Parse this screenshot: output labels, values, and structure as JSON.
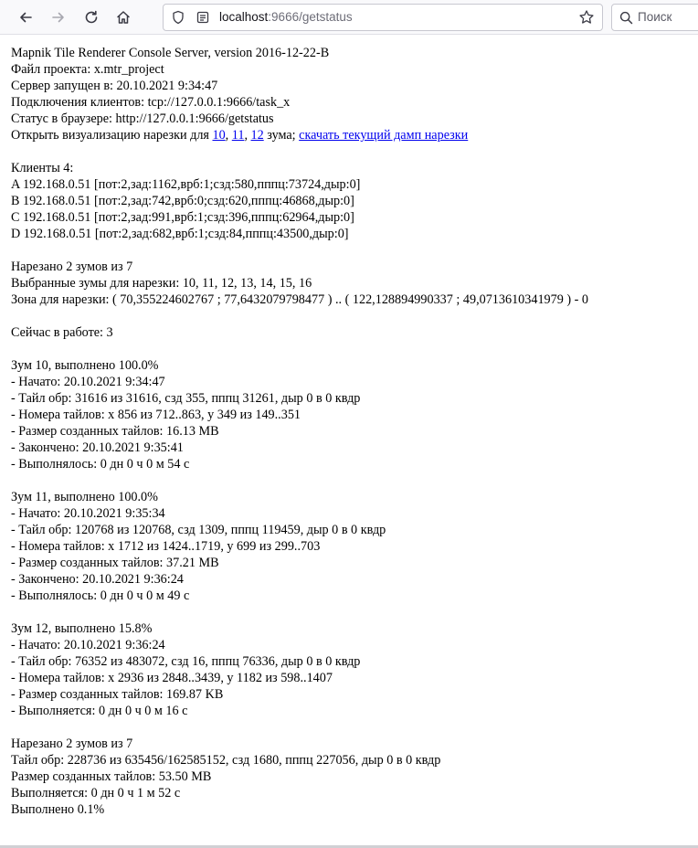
{
  "browser": {
    "url_host": "localhost",
    "url_rest": ":9666/getstatus",
    "search_placeholder": "Поиск"
  },
  "page": {
    "header": [
      "Mapnik Tile Renderer Console Server, version 2016-12-22-B",
      "Файл проекта: x.mtr_project",
      "Сервер запущен в: 20.10.2021 9:34:47",
      "Подключения клиентов: tcp://127.0.0.1:9666/task_x",
      "Статус в браузере: http://127.0.0.1:9666/getstatus"
    ],
    "viz_line": {
      "prefix": "Открыть визуализацию нарезки для ",
      "link_10": "10",
      "sep1": ", ",
      "link_11": "11",
      "sep2": ", ",
      "link_12": "12",
      "suffix": " зума; ",
      "dump_link": "скачать текущий дамп нарезки"
    },
    "clients": [
      "Клиенты 4:",
      "A 192.168.0.51 [пот:2,зад:1162,врб:1;сзд:580,пппц:73724,дыр:0]",
      "B 192.168.0.51 [пот:2,зад:742,врб:0;сзд:620,пппц:46868,дыр:0]",
      "C 192.168.0.51 [пот:2,зад:991,врб:1;сзд:396,пппц:62964,дыр:0]",
      "D 192.168.0.51 [пот:2,зад:682,врб:1;сзд:84,пппц:43500,дыр:0]"
    ],
    "summary": [
      "Нарезано 2 зумов из 7",
      "Выбранные зумы для нарезки: 10, 11, 12, 13, 14, 15, 16",
      "Зона для нарезки: ( 70,355224602767 ; 77,6432079798477 ) .. ( 122,128894990337 ; 49,0713610341979 ) - 0"
    ],
    "working": "Сейчас в работе: 3",
    "zoom10": [
      "Зум 10, выполнено 100.0%",
      "- Начато: 20.10.2021 9:34:47",
      "- Тайл обр: 31616 из 31616, сзд 355, пппц 31261, дыр 0 в 0 квдр",
      "- Номера тайлов: x 856 из 712..863, y 349 из 149..351",
      "- Размер созданных тайлов: 16.13 MB",
      "- Закончено: 20.10.2021 9:35:41",
      "- Выполнялось: 0 дн 0 ч 0 м 54 с"
    ],
    "zoom11": [
      "Зум 11, выполнено 100.0%",
      "- Начато: 20.10.2021 9:35:34",
      "- Тайл обр: 120768 из 120768, сзд 1309, пппц 119459, дыр 0 в 0 квдр",
      "- Номера тайлов: x 1712 из 1424..1719, y 699 из 299..703",
      "- Размер созданных тайлов: 37.21 MB",
      "- Закончено: 20.10.2021 9:36:24",
      "- Выполнялось: 0 дн 0 ч 0 м 49 с"
    ],
    "zoom12": [
      "Зум 12, выполнено 15.8%",
      "- Начато: 20.10.2021 9:36:24",
      "- Тайл обр: 76352 из 483072, сзд 16, пппц 76336, дыр 0 в 0 квдр",
      "- Номера тайлов: x 2936 из 2848..3439, y 1182 из 598..1407",
      "- Размер созданных тайлов: 169.87 KB",
      "- Выполняется: 0 дн 0 ч 0 м 16 с"
    ],
    "total": [
      "Нарезано 2 зумов из 7",
      "Тайл обр: 228736 из 635456/162585152, сзд 1680, пппц 227056, дыр 0 в 0 квдр",
      "Размер созданных тайлов: 53.50 MB",
      "Выполняется: 0 дн 0 ч 1 м 52 с",
      "Выполнено 0.1%"
    ]
  }
}
